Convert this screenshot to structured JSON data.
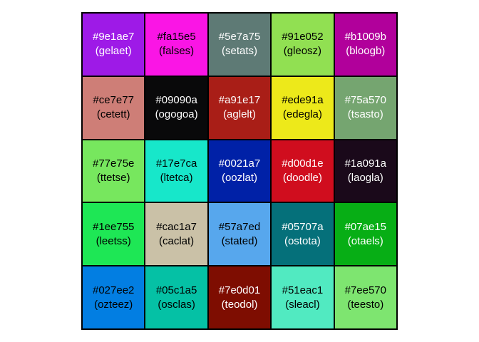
{
  "swatches": [
    {
      "hex": "#9e1ae7",
      "name": "(gelaet)",
      "text_color": "#ffffff"
    },
    {
      "hex": "#fa15e5",
      "name": "(falses)",
      "text_color": "#000000"
    },
    {
      "hex": "#5e7a75",
      "name": "(setats)",
      "text_color": "#ffffff"
    },
    {
      "hex": "#91e052",
      "name": "(gleosz)",
      "text_color": "#000000"
    },
    {
      "hex": "#b1009b",
      "name": "(bloogb)",
      "text_color": "#ffffff"
    },
    {
      "hex": "#ce7e77",
      "name": "(cetett)",
      "text_color": "#000000"
    },
    {
      "hex": "#09090a",
      "name": "(ogogoa)",
      "text_color": "#ffffff"
    },
    {
      "hex": "#a91e17",
      "name": "(aglelt)",
      "text_color": "#ffffff"
    },
    {
      "hex": "#ede91a",
      "name": "(edegla)",
      "text_color": "#000000"
    },
    {
      "hex": "#75a570",
      "name": "(tsasto)",
      "text_color": "#ffffff"
    },
    {
      "hex": "#77e75e",
      "name": "(ttetse)",
      "text_color": "#000000"
    },
    {
      "hex": "#17e7ca",
      "name": "(ltetca)",
      "text_color": "#000000"
    },
    {
      "hex": "#0021a7",
      "name": "(oozlat)",
      "text_color": "#ffffff"
    },
    {
      "hex": "#d00d1e",
      "name": "(doodle)",
      "text_color": "#ffffff"
    },
    {
      "hex": "#1a091a",
      "name": "(laogla)",
      "text_color": "#ffffff"
    },
    {
      "hex": "#1ee755",
      "name": "(leetss)",
      "text_color": "#000000"
    },
    {
      "hex": "#cac1a7",
      "name": "(caclat)",
      "text_color": "#000000"
    },
    {
      "hex": "#57a7ed",
      "name": "(stated)",
      "text_color": "#000000"
    },
    {
      "hex": "#05707a",
      "name": "(ostota)",
      "text_color": "#ffffff"
    },
    {
      "hex": "#07ae15",
      "name": "(otaels)",
      "text_color": "#ffffff"
    },
    {
      "hex": "#027ee2",
      "name": "(ozteez)",
      "text_color": "#000000"
    },
    {
      "hex": "#05c1a5",
      "name": "(osclas)",
      "text_color": "#000000"
    },
    {
      "hex": "#7e0d01",
      "name": "(teodol)",
      "text_color": "#ffffff"
    },
    {
      "hex": "#51eac1",
      "name": "(sleacl)",
      "text_color": "#000000"
    },
    {
      "hex": "#7ee570",
      "name": "(teesto)",
      "text_color": "#000000"
    }
  ]
}
